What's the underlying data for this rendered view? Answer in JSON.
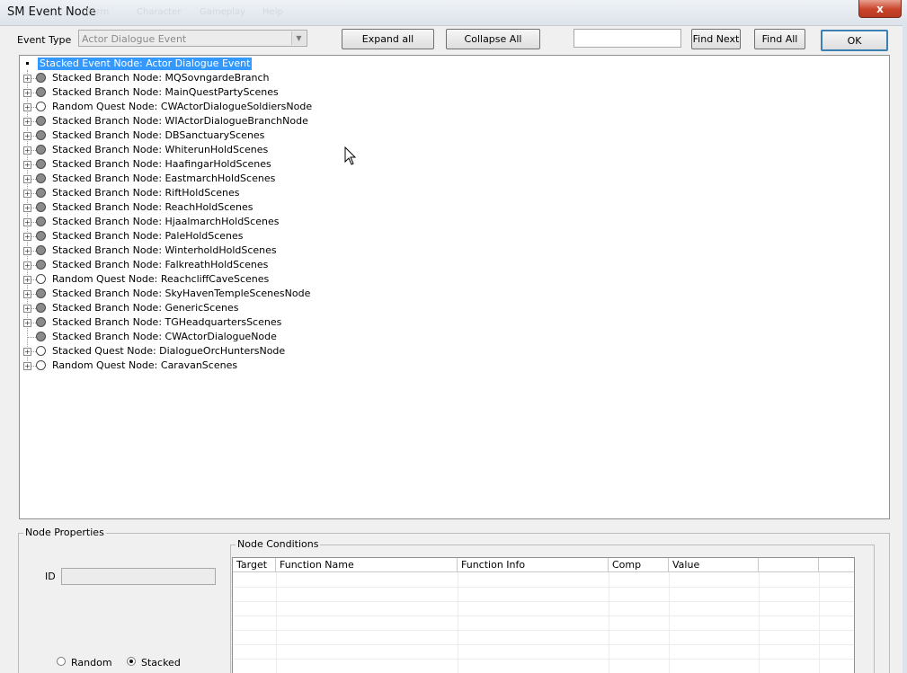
{
  "window": {
    "title": "SM Event Node",
    "close_glyph": "x",
    "ghost_menu": [
      "Form",
      "Character",
      "Gameplay",
      "Help"
    ]
  },
  "toolbar": {
    "event_type_label": "Event Type",
    "event_type_value": "Actor Dialogue Event",
    "expand_all": "Expand all",
    "collapse_all": "Collapse All",
    "search_value": "",
    "find_next": "Find Next",
    "find_all": "Find All",
    "ok": "OK"
  },
  "tree": {
    "root": "Stacked Event Node: Actor Dialogue Event",
    "items": [
      {
        "label": "Stacked Branch Node: MQSovngardeBranch",
        "icon": "filled-circle-icon",
        "expandable": true
      },
      {
        "label": "Stacked Branch Node: MainQuestPartyScenes",
        "icon": "filled-circle-icon",
        "expandable": true
      },
      {
        "label": "Random Quest Node: CWActorDialogueSoldiersNode",
        "icon": "empty-circle-icon",
        "expandable": true
      },
      {
        "label": "Stacked Branch Node: WIActorDialogueBranchNode",
        "icon": "filled-circle-icon",
        "expandable": true
      },
      {
        "label": "Stacked Branch Node: DBSanctuaryScenes",
        "icon": "filled-circle-icon",
        "expandable": true
      },
      {
        "label": "Stacked Branch Node: WhiterunHoldScenes",
        "icon": "filled-circle-icon",
        "expandable": true
      },
      {
        "label": "Stacked Branch Node: HaafingarHoldScenes",
        "icon": "filled-circle-icon",
        "expandable": true
      },
      {
        "label": "Stacked Branch Node: EastmarchHoldScenes",
        "icon": "filled-circle-icon",
        "expandable": true
      },
      {
        "label": "Stacked Branch Node: RiftHoldScenes",
        "icon": "filled-circle-icon",
        "expandable": true
      },
      {
        "label": "Stacked Branch Node: ReachHoldScenes",
        "icon": "filled-circle-icon",
        "expandable": true
      },
      {
        "label": "Stacked Branch Node: HjaalmarchHoldScenes",
        "icon": "filled-circle-icon",
        "expandable": true
      },
      {
        "label": "Stacked Branch Node: PaleHoldScenes",
        "icon": "filled-circle-icon",
        "expandable": true
      },
      {
        "label": "Stacked Branch Node: WinterholdHoldScenes",
        "icon": "filled-circle-icon",
        "expandable": true
      },
      {
        "label": "Stacked Branch Node: FalkreathHoldScenes",
        "icon": "filled-circle-icon",
        "expandable": true
      },
      {
        "label": "Random Quest Node: ReachcliffCaveScenes",
        "icon": "empty-circle-icon",
        "expandable": true
      },
      {
        "label": "Stacked Branch Node: SkyHavenTempleScenesNode",
        "icon": "filled-circle-icon",
        "expandable": true
      },
      {
        "label": "Stacked Branch Node: GenericScenes",
        "icon": "filled-circle-icon",
        "expandable": true
      },
      {
        "label": "Stacked Branch Node: TGHeadquartersScenes",
        "icon": "filled-circle-icon",
        "expandable": true
      },
      {
        "label": "Stacked Branch Node: CWActorDialogueNode",
        "icon": "filled-circle-icon",
        "expandable": false
      },
      {
        "label": "Stacked Quest Node: DialogueOrcHuntersNode",
        "icon": "empty-circle-icon",
        "expandable": true
      },
      {
        "label": "Random Quest Node: CaravanScenes",
        "icon": "empty-circle-icon",
        "expandable": true
      }
    ]
  },
  "node_properties": {
    "title": "Node Properties",
    "id_label": "ID",
    "id_value": "",
    "random_label": "Random",
    "stacked_label": "Stacked",
    "selected_mode": "Stacked"
  },
  "node_conditions": {
    "title": "Node Conditions",
    "columns": [
      "Target",
      "Function Name",
      "Function Info",
      "Comp",
      "Value",
      ""
    ]
  },
  "colors": {
    "selection": "#3399ff",
    "close_button": "#c8432a",
    "default_button_border": "#3c7fb1"
  }
}
